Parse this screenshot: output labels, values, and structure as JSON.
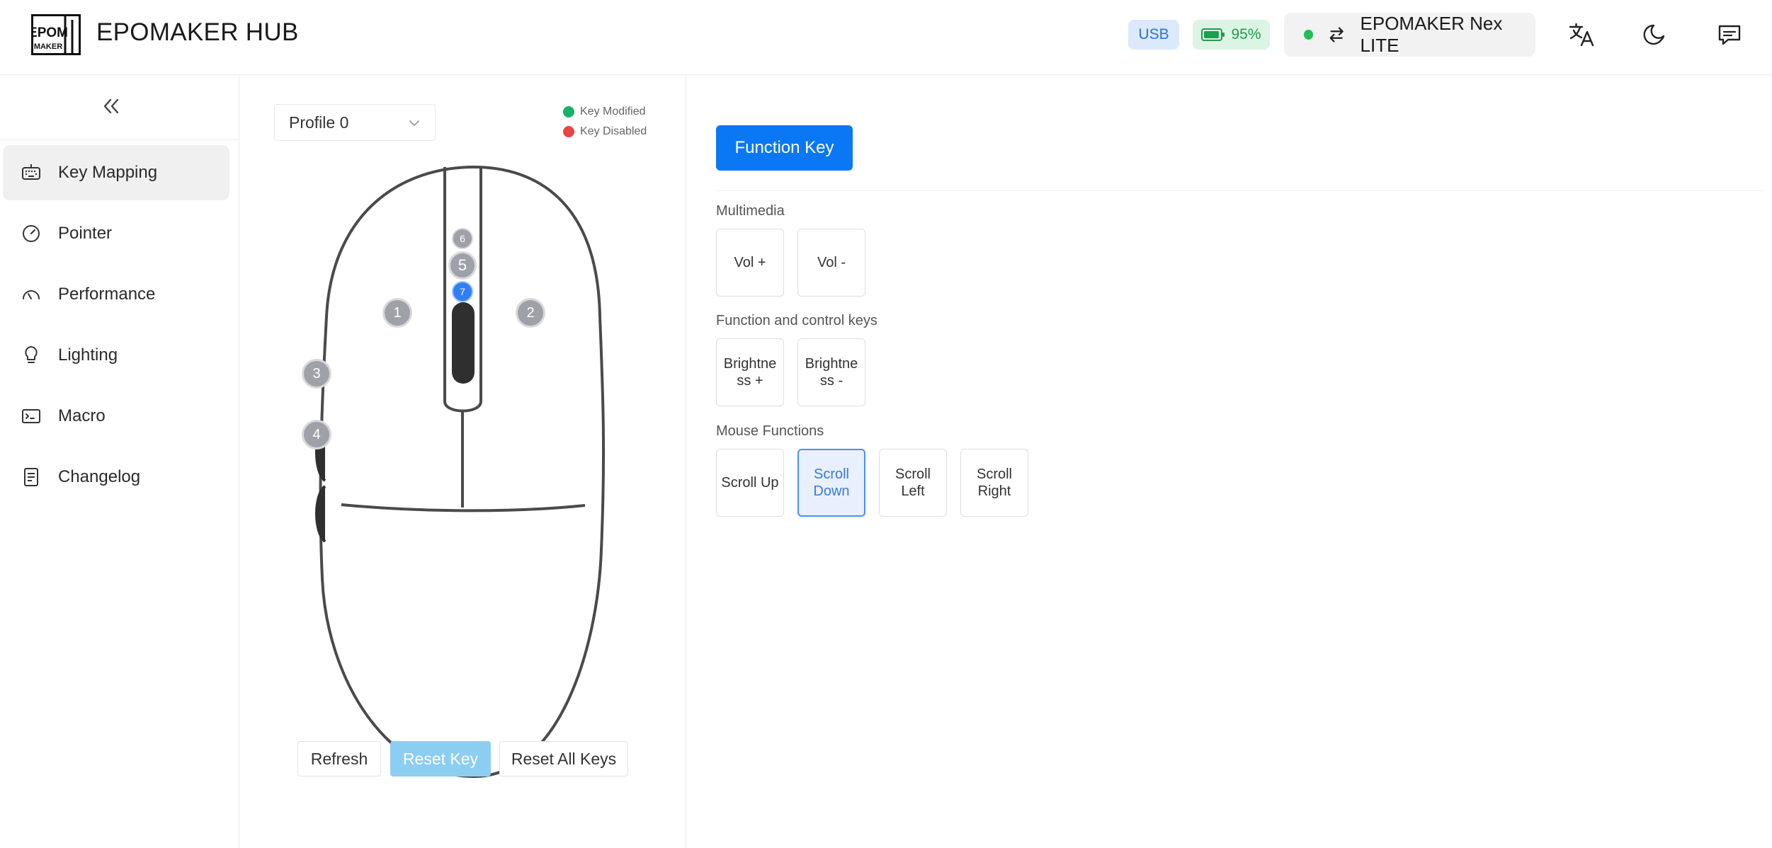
{
  "header": {
    "brand": "EPOMAKER HUB",
    "logo_text": [
      "EPOM",
      "MAKER"
    ],
    "connection": "USB",
    "battery": "95%",
    "battery_level": 0.95,
    "device_name": "EPOMAKER Nex LITE",
    "device_status_color": "#1fbf55",
    "icons": [
      "translate-icon",
      "moon-icon",
      "feedback-icon"
    ]
  },
  "sidebar": {
    "items": [
      {
        "label": "Key Mapping",
        "icon": "keyboard-icon",
        "active": true
      },
      {
        "label": "Pointer",
        "icon": "gauge-icon",
        "active": false
      },
      {
        "label": "Performance",
        "icon": "speedometer-icon",
        "active": false
      },
      {
        "label": "Lighting",
        "icon": "bulb-icon",
        "active": false
      },
      {
        "label": "Macro",
        "icon": "terminal-icon",
        "active": false
      },
      {
        "label": "Changelog",
        "icon": "document-icon",
        "active": false
      }
    ]
  },
  "mouse": {
    "profile": "Profile 0",
    "legend": {
      "modified": "Key Modified",
      "disabled": "Key Disabled"
    },
    "legend_colors": {
      "modified": "#16b26a",
      "disabled": "#e84545"
    },
    "keys": [
      "1",
      "2",
      "3",
      "4",
      "5",
      "6",
      "7"
    ],
    "selected_key": "7",
    "buttons": {
      "refresh": "Refresh",
      "reset_key": "Reset Key",
      "reset_all": "Reset All Keys"
    }
  },
  "content": {
    "tab": "Function Key",
    "sections": [
      {
        "title": "Multimedia",
        "keys": [
          "Vol +",
          "Vol -"
        ]
      },
      {
        "title": "Function and control keys",
        "keys": [
          "Brightne ss +",
          "Brightne ss -"
        ]
      },
      {
        "title": "Mouse Functions",
        "keys": [
          "Scroll Up",
          "Scroll Down",
          "Scroll Left",
          "Scroll Right"
        ]
      }
    ],
    "selected_key": "Scroll Down",
    "accent": "#0a78f5"
  }
}
